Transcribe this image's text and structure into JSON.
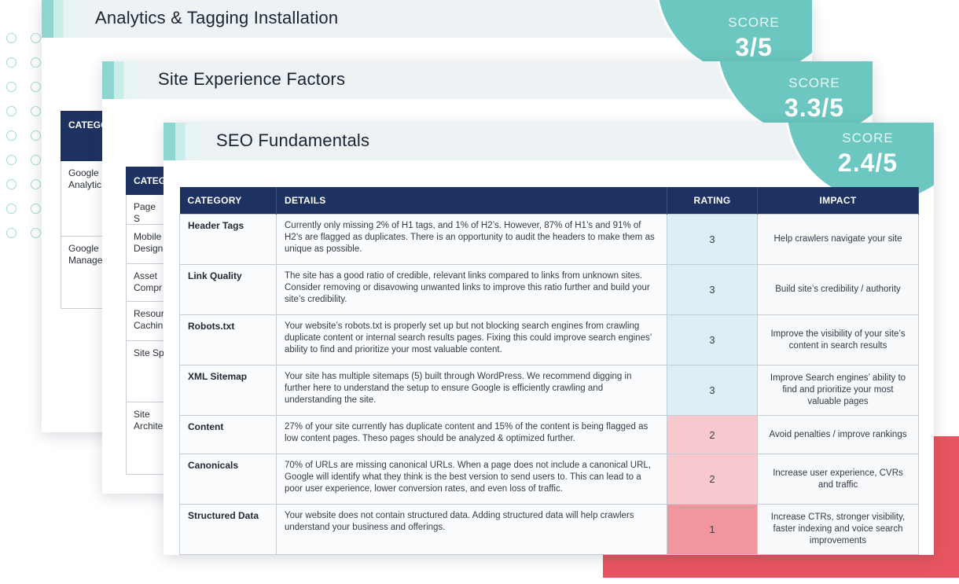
{
  "colors": {
    "teal": "#6cc7c0",
    "navy": "#1e3261",
    "red": "#e85560",
    "rating_3": "#dbeff4",
    "rating_2": "#f8c8cf",
    "rating_1": "#f1959f"
  },
  "cards": {
    "analytics": {
      "title": "Analytics & Tagging Installation",
      "score_label": "SCORE",
      "score": "3/5",
      "col_header": "CATEGO",
      "rows": [
        "Google\nAnalytic",
        "Google\nManage"
      ]
    },
    "experience": {
      "title": "Site Experience Factors",
      "score_label": "SCORE",
      "score": "3.3/5",
      "col_header": "CATEG",
      "rows": [
        "Page S",
        "Mobile\nDesign",
        "Asset\nCompr",
        "Resour\nCachin",
        "Site Sp",
        "Site\nArchite"
      ]
    },
    "seo": {
      "title": "SEO Fundamentals",
      "score_label": "SCORE",
      "score": "2.4/5",
      "headers": [
        "CATEGORY",
        "DETAILS",
        "RATING",
        "IMPACT"
      ],
      "rows": [
        {
          "category": "Header Tags",
          "details": "Currently only missing 2% of H1 tags, and 1% of H2’s. However, 87% of H1’s and 91% of H2’s are flagged as duplicates. There is an opportunity to audit the headers to make them as unique as possible.",
          "rating": "3",
          "impact": "Help crawlers navigate your site"
        },
        {
          "category": "Link Quality",
          "details": "The site has a good ratio of credible, relevant links compared to links from unknown sites. Consider removing or disavowing unwanted links to improve this ratio further and build your site’s credibility.",
          "rating": "3",
          "impact": "Build site’s credibility / authority"
        },
        {
          "category": "Robots.txt",
          "details": "Your website’s robots.txt is properly set up but not blocking search engines from crawling duplicate content or internal search results pages. Fixing this could improve search engines’ ability to find and prioritize your most valuable content.",
          "rating": "3",
          "impact": "Improve the visibility of your site’s content in search results"
        },
        {
          "category": "XML Sitemap",
          "details": "Your site has multiple sitemaps (5) built through WordPress. We recommend digging in further here to understand the setup to ensure Google is efficiently crawling and understanding the site.",
          "rating": "3",
          "impact": "Improve Search engines’ ability to find and prioritize your most valuable pages"
        },
        {
          "category": "Content",
          "details": "27% of your site currently has duplicate content and 15% of the content is being flagged as low content pages. Theso pages should be analyzed & optimized further.",
          "rating": "2",
          "impact": "Avoid penalties / improve rankings"
        },
        {
          "category": "Canonicals",
          "details": "70% of URLs are missing canonical URLs. When a page does not include a canonical URL, Google will identify what they think is the best version to send users to. This can lead to a poor user experience, lower conversion rates, and even loss of traffic.",
          "rating": "2",
          "impact": "Increase user experience, CVRs and traffic"
        },
        {
          "category": "Structured Data",
          "details": "Your website does not contain structured data. Adding structured data will help crawlers understand your business and offerings.",
          "rating": "1",
          "impact": "Increase CTRs, stronger visibility, faster indexing and voice search improvements"
        }
      ]
    }
  }
}
